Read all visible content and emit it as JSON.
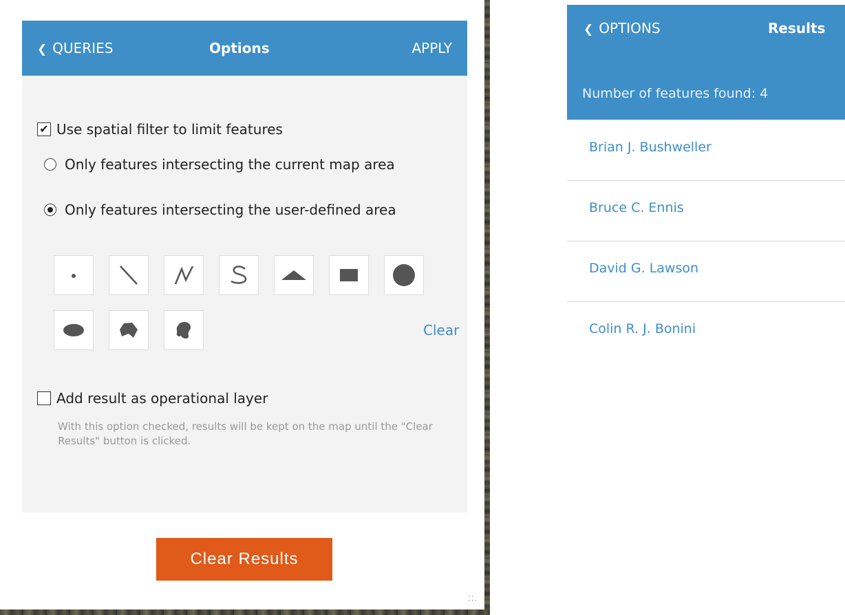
{
  "options_panel": {
    "back_label": "QUERIES",
    "title": "Options",
    "apply_label": "APPLY",
    "spatial_filter_label": "Use spatial filter to limit features",
    "spatial_filter_checked": true,
    "radio_current_map": "Only features intersecting the current map area",
    "radio_user_defined": "Only features intersecting the user-defined area",
    "selected_radio": "user_defined",
    "draw_tools": [
      "point",
      "line",
      "polyline",
      "freehand-polyline",
      "triangle",
      "rectangle",
      "circle",
      "ellipse",
      "polygon",
      "freehand-polygon"
    ],
    "clear_label": "Clear",
    "add_layer_label": "Add result as operational layer",
    "add_layer_checked": false,
    "hint": "With this option checked, results will be kept on the map until the \"Clear Results\" button is clicked."
  },
  "clear_results_label": "Clear Results",
  "results_panel": {
    "back_label": "OPTIONS",
    "title": "Results",
    "count_text": "Number of features found: 4",
    "items": [
      "Brian J. Bushweller",
      "Bruce C. Ennis",
      "David G. Lawson",
      "Colin R. J. Bonini"
    ]
  },
  "colors": {
    "header_blue": "#3e8ec8",
    "clear_button": "#e05a1a",
    "panel_bg": "#f3f3f3"
  }
}
